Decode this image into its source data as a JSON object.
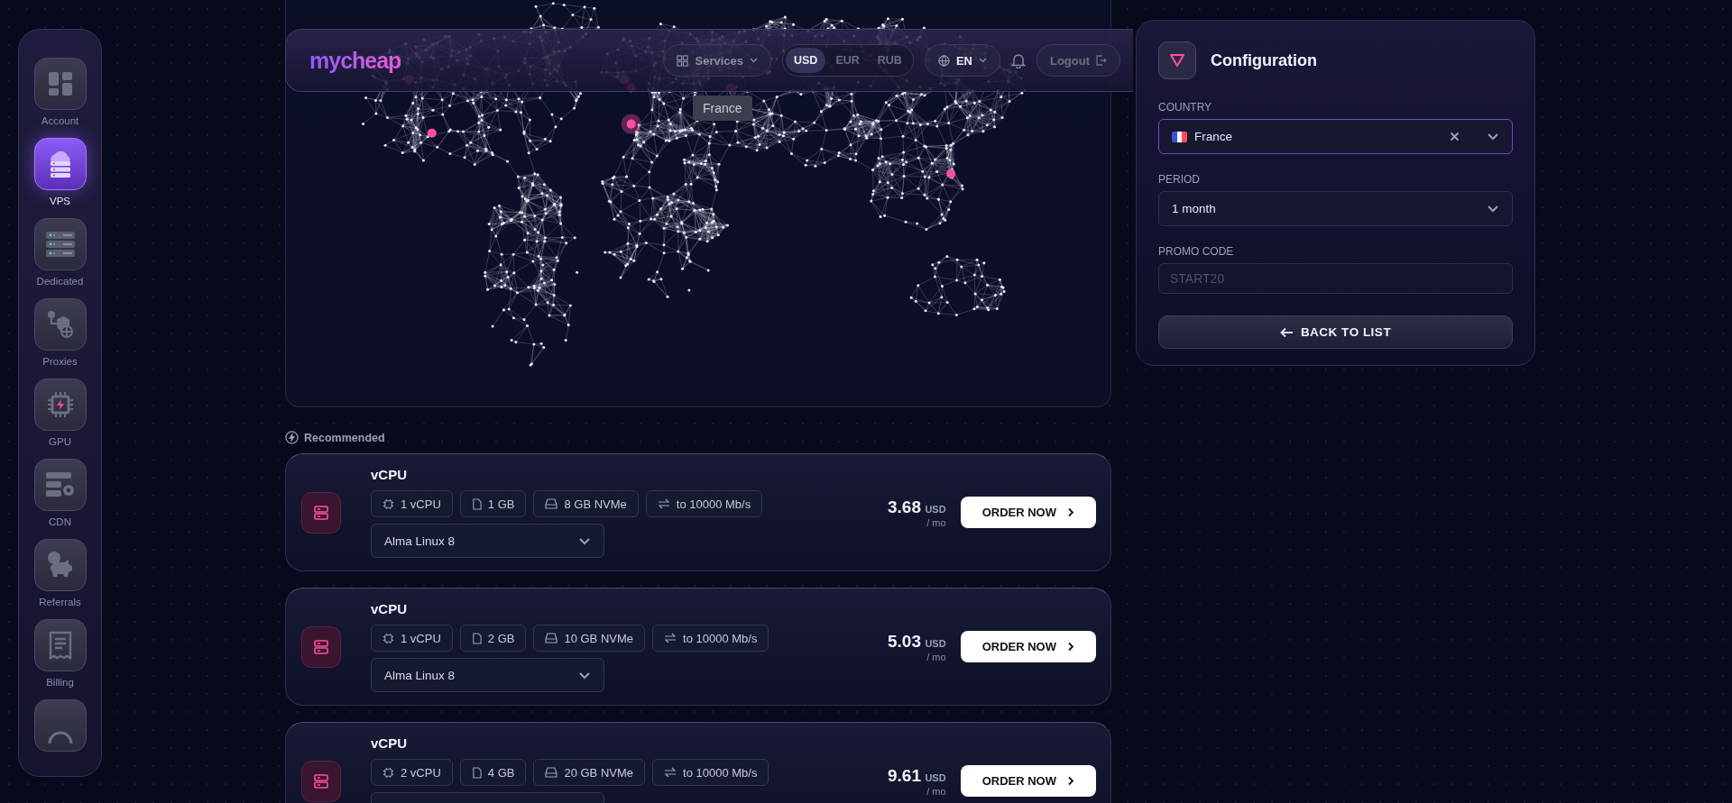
{
  "sidebar": {
    "items": [
      {
        "label": "Account",
        "kind": "account",
        "selected": false
      },
      {
        "label": "VPS",
        "kind": "vps",
        "selected": true
      },
      {
        "label": "Dedicated",
        "kind": "dedicated",
        "selected": false
      },
      {
        "label": "Proxies",
        "kind": "proxies",
        "selected": false
      },
      {
        "label": "GPU",
        "kind": "gpu",
        "selected": false
      },
      {
        "label": "CDN",
        "kind": "cdn",
        "selected": false
      },
      {
        "label": "Referrals",
        "kind": "referrals",
        "selected": false
      },
      {
        "label": "Billing",
        "kind": "billing",
        "selected": false
      }
    ]
  },
  "header": {
    "logo": "mycheap",
    "services": "Services",
    "currencies": [
      {
        "label": "USD",
        "selected": true
      },
      {
        "label": "EUR",
        "selected": false
      },
      {
        "label": "RUB",
        "selected": false
      }
    ],
    "language": "EN",
    "logout": "Logout"
  },
  "map": {
    "tooltip": "France"
  },
  "recommended": "Recommended",
  "plans": [
    {
      "title": "vCPU",
      "specs": [
        {
          "kind": "cpu",
          "text": "1 vCPU"
        },
        {
          "kind": "ram",
          "text": "1 GB"
        },
        {
          "kind": "disk",
          "text": "8 GB NVMe"
        },
        {
          "kind": "speed",
          "text": "to 10000 Mb/s"
        }
      ],
      "os": "Alma Linux 8",
      "price": "3.68",
      "currency": "USD",
      "period": "/ mo",
      "button": "ORDER NOW"
    },
    {
      "title": "vCPU",
      "specs": [
        {
          "kind": "cpu",
          "text": "1 vCPU"
        },
        {
          "kind": "ram",
          "text": "2 GB"
        },
        {
          "kind": "disk",
          "text": "10 GB NVMe"
        },
        {
          "kind": "speed",
          "text": "to 10000 Mb/s"
        }
      ],
      "os": "Alma Linux 8",
      "price": "5.03",
      "currency": "USD",
      "period": "/ mo",
      "button": "ORDER NOW"
    },
    {
      "title": "vCPU",
      "specs": [
        {
          "kind": "cpu",
          "text": "2 vCPU"
        },
        {
          "kind": "ram",
          "text": "4 GB"
        },
        {
          "kind": "disk",
          "text": "20 GB NVMe"
        },
        {
          "kind": "speed",
          "text": "to 10000 Mb/s"
        }
      ],
      "price": "9.61",
      "currency": "USD",
      "period": "/ mo",
      "button": "ORDER NOW"
    }
  ],
  "configuration": {
    "title": "Configuration",
    "country": {
      "label": "COUNTRY",
      "value": "France",
      "focused": true
    },
    "period": {
      "label": "PERIOD",
      "value": "1 month"
    },
    "promo": {
      "label": "PROMO CODE",
      "placeholder": "START20"
    },
    "back": "BACK TO LIST"
  }
}
